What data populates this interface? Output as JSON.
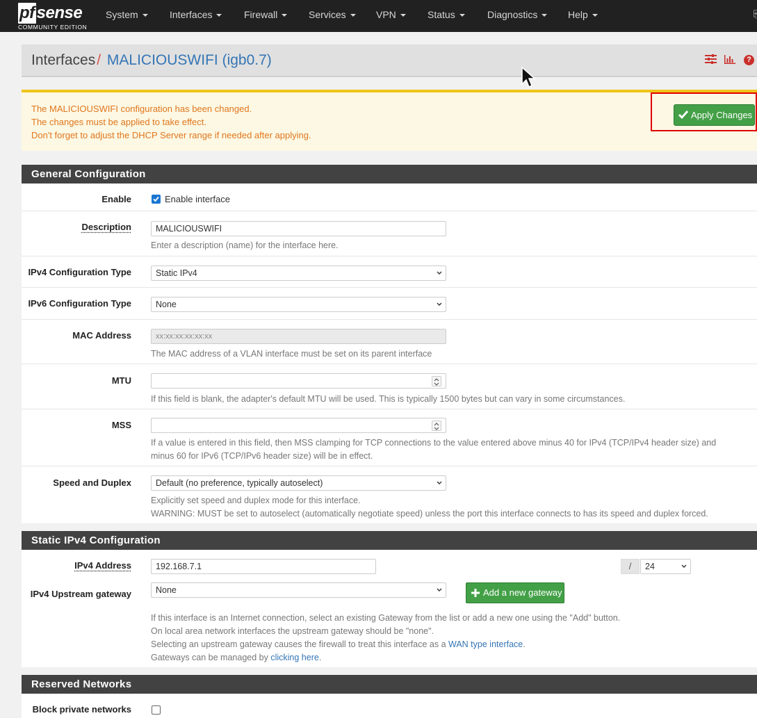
{
  "nav": {
    "logo_text": "pfsense",
    "logo_sub": "COMMUNITY EDITION",
    "items": [
      "System",
      "Interfaces",
      "Firewall",
      "Services",
      "VPN",
      "Status",
      "Diagnostics",
      "Help"
    ]
  },
  "breadcrumb": {
    "parent": "Interfaces",
    "separator": "/",
    "current": "MALICIOUSWIFI (igb0.7)"
  },
  "alert": {
    "lines": [
      "The MALICIOUSWIFI configuration has been changed.",
      "The changes must be applied to take effect.",
      "Don't forget to adjust the DHCP Server range if needed after applying."
    ],
    "apply_label": "Apply Changes"
  },
  "general": {
    "title": "General Configuration",
    "enable_label": "Enable",
    "enable_checkbox_label": "Enable interface",
    "enable_checked": true,
    "description_label": "Description",
    "description_value": "MALICIOUSWIFI",
    "description_help": "Enter a description (name) for the interface here.",
    "ipv4_type_label": "IPv4 Configuration Type",
    "ipv4_type_value": "Static IPv4",
    "ipv6_type_label": "IPv6 Configuration Type",
    "ipv6_type_value": "None",
    "mac_label": "MAC Address",
    "mac_placeholder": "xx:xx:xx:xx:xx:xx",
    "mac_help": "The MAC address of a VLAN interface must be set on its parent interface",
    "mtu_label": "MTU",
    "mtu_help": "If this field is blank, the adapter's default MTU will be used. This is typically 1500 bytes but can vary in some circumstances.",
    "mss_label": "MSS",
    "mss_help_1": "If a value is entered in this field, then MSS clamping for TCP connections to the value entered above minus 40 for IPv4 (TCP/IPv4 header size) and",
    "mss_help_2": "minus 60 for IPv6 (TCP/IPv6 header size) will be in effect.",
    "speed_label": "Speed and Duplex",
    "speed_value": "Default (no preference, typically autoselect)",
    "speed_help_1": "Explicitly set speed and duplex mode for this interface.",
    "speed_help_2": "WARNING: MUST be set to autoselect (automatically negotiate speed) unless the port this interface connects to has its speed and duplex forced."
  },
  "static_ipv4": {
    "title": "Static IPv4 Configuration",
    "address_label": "IPv4 Address",
    "address_value": "192.168.7.1",
    "slash": "/",
    "cidr_value": "24",
    "gateway_label": "IPv4 Upstream gateway",
    "gateway_value": "None",
    "add_gateway_label": "Add a new gateway",
    "help_1": "If this interface is an Internet connection, select an existing Gateway from the list or add a new one using the \"Add\" button.",
    "help_2": "On local area network interfaces the upstream gateway should be \"none\".",
    "help_3_prefix": "Selecting an upstream gateway causes the firewall to treat this interface as a ",
    "help_3_link": "WAN type interface",
    "help_3_suffix": ".",
    "help_4_prefix": "Gateways can be managed by ",
    "help_4_link": "clicking here",
    "help_4_suffix": "."
  },
  "reserved": {
    "title": "Reserved Networks",
    "block_private_label": "Block private networks",
    "block_private_checked": false
  },
  "colors": {
    "nav_bg": "#212121",
    "section_bg": "#424242",
    "accent_green": "#43a047",
    "alert_text": "#e0761e",
    "link": "#3475b5",
    "highlight_red": "#e00000"
  }
}
